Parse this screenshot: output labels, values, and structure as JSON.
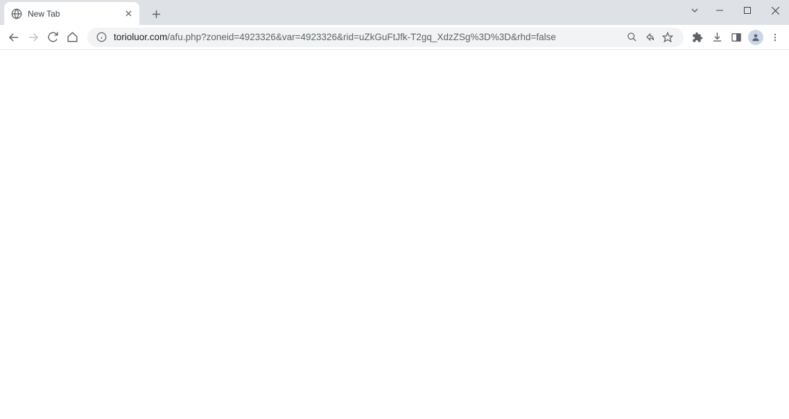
{
  "tab": {
    "title": "New Tab"
  },
  "url": {
    "domain": "torioluor.com",
    "path": "/afu.php?zoneid=4923326&var=4923326&rid=uZkGuFtJfk-T2gq_XdzZSg%3D%3D&rhd=false"
  }
}
